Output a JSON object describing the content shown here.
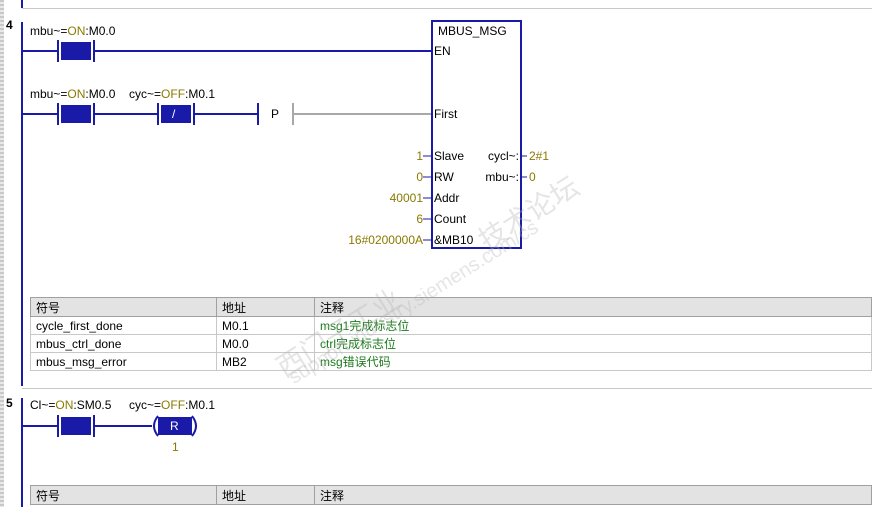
{
  "network4": {
    "number": "4",
    "rung1_label": {
      "sym": "mbu~",
      "eq": "=",
      "state": "ON",
      "sep": ":",
      "addr": "M0.0"
    },
    "rung2_label1": {
      "sym": "mbu~",
      "eq": "=",
      "state": "ON",
      "sep": ":",
      "addr": "M0.0"
    },
    "rung2_label2": {
      "sym": "cyc~",
      "eq": "=",
      "state": "OFF",
      "sep": ":",
      "addr": "M0.1"
    },
    "not_contact": "/",
    "p_contact": "P",
    "block": {
      "title": "MBUS_MSG",
      "inputs": [
        {
          "pin": "EN",
          "value": ""
        },
        {
          "pin": "First",
          "value": ""
        },
        {
          "pin": "Slave",
          "value": "1"
        },
        {
          "pin": "RW",
          "value": "0"
        },
        {
          "pin": "Addr",
          "value": "40001"
        },
        {
          "pin": "Count",
          "value": "6"
        },
        {
          "pin": "&MB10",
          "value": "16#0200000A"
        }
      ],
      "outputs": [
        {
          "pin": "cycl~:",
          "value": "2#1"
        },
        {
          "pin": "mbu~:",
          "value": "0"
        }
      ]
    },
    "symbol_table": {
      "headers": [
        "符号",
        "地址",
        "注释"
      ],
      "rows": [
        {
          "symbol": "cycle_first_done",
          "address": "M0.1",
          "comment": "msg1完成标志位"
        },
        {
          "symbol": "mbus_ctrl_done",
          "address": "M0.0",
          "comment": "ctrl完成标志位"
        },
        {
          "symbol": "mbus_msg_error",
          "address": "MB2",
          "comment": "msg错误代码"
        }
      ]
    }
  },
  "network5": {
    "number": "5",
    "label1": {
      "sym": "Cl~",
      "eq": "=",
      "state": "ON",
      "sep": ":",
      "addr": "SM0.5"
    },
    "label2": {
      "sym": "cyc~",
      "eq": "=",
      "state": "OFF",
      "sep": ":",
      "addr": "M0.1"
    },
    "coil": "R",
    "coil_count": "1",
    "symbol_table": {
      "headers": [
        "符号",
        "地址",
        "注释"
      ]
    }
  },
  "watermark": {
    "line1": "西门子工业",
    "line2": "support.industry.siemens.com/cs",
    "line3": "技术论坛"
  },
  "colors": {
    "rung": "#1a1aa8",
    "contact": "#0a0aa0",
    "state": "#8a7a00",
    "comment": "#1b7a1b"
  }
}
